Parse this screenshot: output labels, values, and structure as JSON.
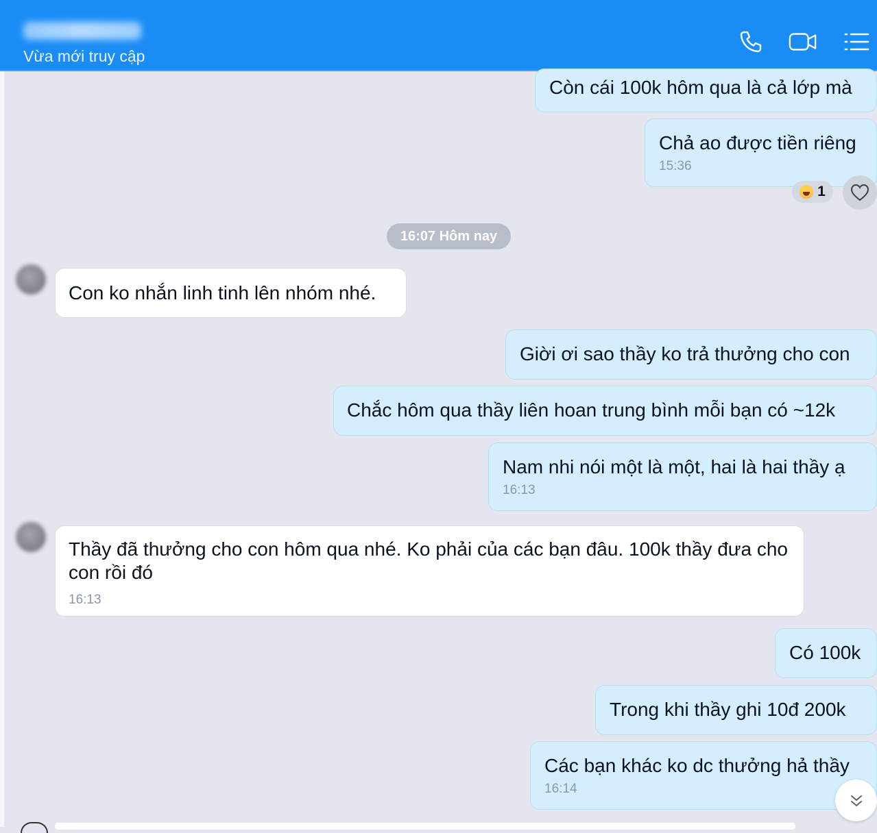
{
  "header": {
    "contact_name": "Bao Tai Bao",
    "status": "Vừa mới truy cập",
    "icons": [
      "phone-icon",
      "video-call-icon",
      "menu-list-icon"
    ],
    "accent_color": "#1a8cf5"
  },
  "messages": [
    {
      "sender": "me",
      "text": "Còn cái 100k hôm qua là cả lớp mà"
    },
    {
      "sender": "me",
      "text": "Chả ao được tiền riêng",
      "time": "15:36",
      "reaction_count": "1"
    },
    {
      "sender": "them",
      "text": "Con ko nhắn linh tinh lên nhóm nhé."
    },
    {
      "sender": "me",
      "text": "Giời ơi sao thầy ko trả thưởng cho con"
    },
    {
      "sender": "me",
      "text": "Chắc hôm qua thầy liên hoan trung bình mỗi bạn có ~12k"
    },
    {
      "sender": "me",
      "text": "Nam nhi nói một là một, hai là hai thầy ạ",
      "time": "16:13"
    },
    {
      "sender": "them",
      "text": "Thầy đã thưởng cho con hôm qua nhé. Ko phải của các bạn đâu. 100k thầy đưa cho con rồi đó",
      "time": "16:13"
    },
    {
      "sender": "me",
      "text": "Có 100k"
    },
    {
      "sender": "me",
      "text": "Trong khi thầy ghi 10đ 200k"
    },
    {
      "sender": "me",
      "text": "Các bạn khác ko dc thưởng hả thầy",
      "time": "16:14"
    }
  ],
  "date_divider": "16:07 Hôm nay",
  "colors": {
    "my_bubble": "#d5eefe",
    "their_bubble": "#ffffff",
    "background": "#e3e6ef"
  }
}
